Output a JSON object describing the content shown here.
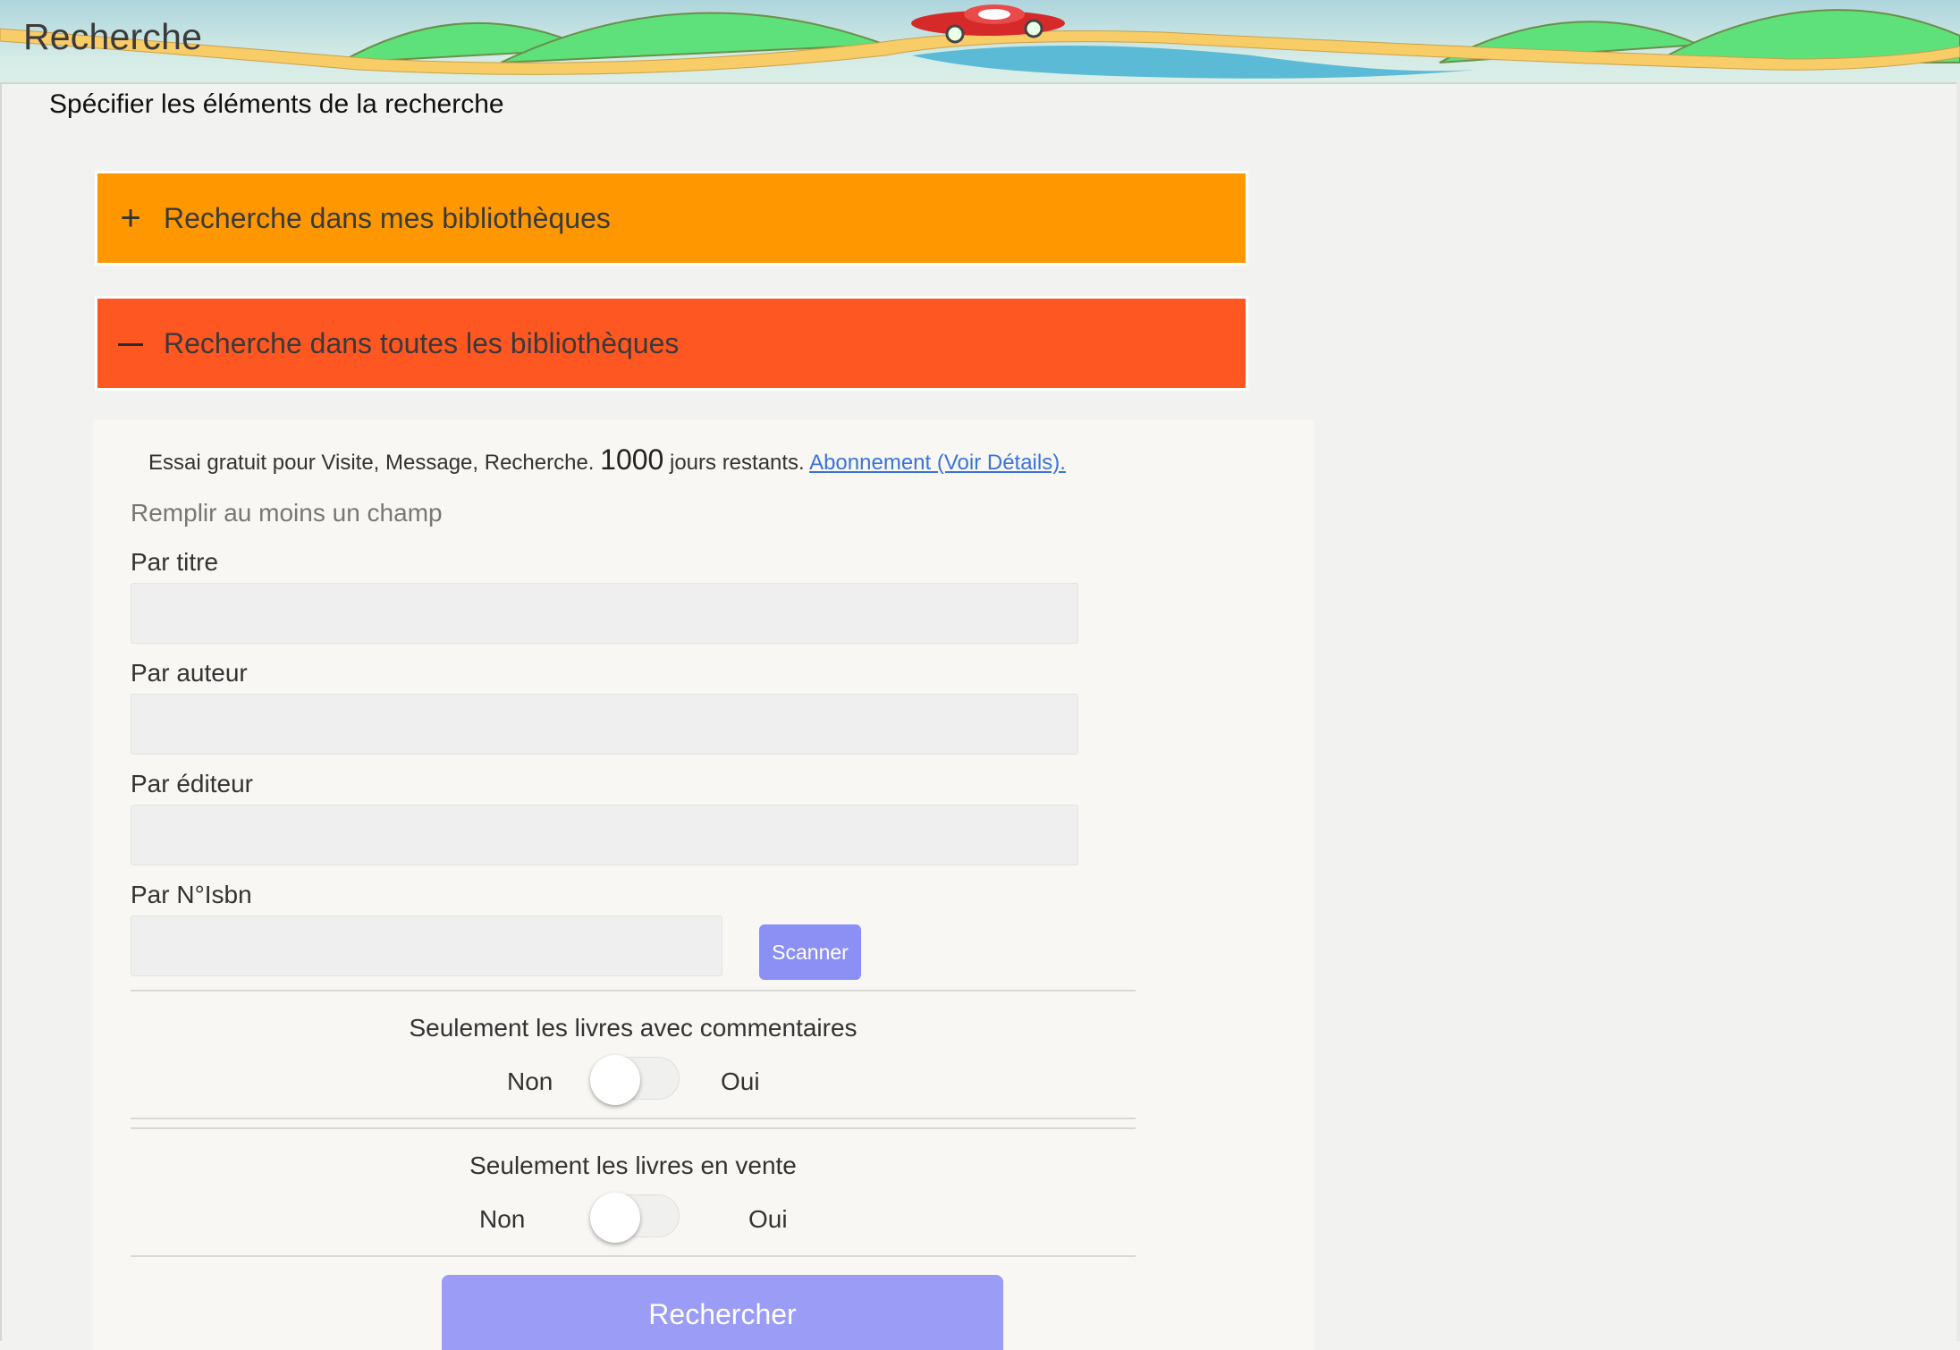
{
  "header": {
    "title": "Recherche"
  },
  "page": {
    "subtitle": "Spécifier les éléments de la recherche"
  },
  "accordion": [
    {
      "label": "Recherche dans mes bibliothèques",
      "icon": "plus-icon",
      "expanded": false,
      "color": "#ff9800"
    },
    {
      "label": "Recherche dans toutes les bibliothèques",
      "icon": "minus-icon",
      "expanded": true,
      "color": "#ff5722"
    }
  ],
  "trial": {
    "prefix": "Essai gratuit pour Visite, Message, Recherche.",
    "days": "1000",
    "suffix": "jours restants.",
    "link": "Abonnement (Voir Détails)."
  },
  "form": {
    "hint": "Remplir au moins un champ",
    "title_label": "Par titre",
    "author_label": "Par auteur",
    "publisher_label": "Par éditeur",
    "isbn_label": "Par N°Isbn",
    "title_value": "",
    "author_value": "",
    "publisher_value": "",
    "isbn_value": "",
    "scan_button": "Scanner"
  },
  "toggles": [
    {
      "title": "Seulement les livres avec commentaires",
      "off_label": "Non",
      "on_label": "Oui",
      "state": false
    },
    {
      "title": "Seulement les livres en vente",
      "off_label": "Non",
      "on_label": "Oui",
      "state": false
    }
  ],
  "search_button": "Rechercher",
  "colors": {
    "accent": "#9b9cf6",
    "orange": "#ff9800",
    "deep_orange": "#ff5722"
  }
}
